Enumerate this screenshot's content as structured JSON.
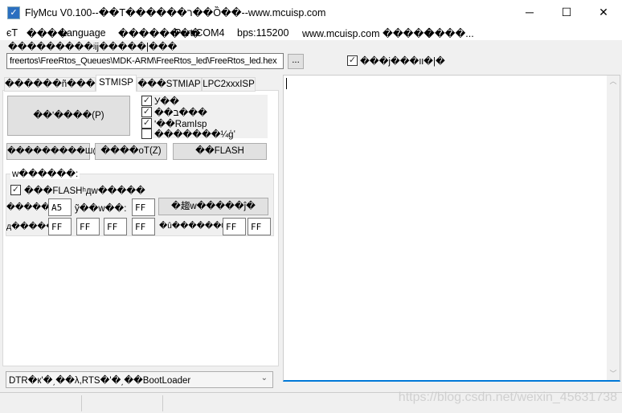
{
  "window": {
    "title": "FlyMcu V0.100--��T������ר��Ȍ��--www.mcuisp.com",
    "minimize": "─",
    "maximize": "☐",
    "close": "✕"
  },
  "menu": [
    "єT",
    "����",
    "Language",
    "��������",
    "Port:COM4",
    "bps:115200",
    "www.mcuisp.com �����",
    "����..."
  ],
  "file": {
    "label": "���������ʲij�����|���",
    "path": "freertos\\FreeRtos_Queues\\MDK-ARM\\FreeRtos_led\\FreeRtos_led.hex",
    "browse": "...",
    "reload_label": "���j���װ�|�",
    "reload_checked": true
  },
  "tabs": [
    {
      "label": "������ñ�����"
    },
    {
      "label": "STMISP",
      "active": true
    },
    {
      "label": "���STMIAP"
    },
    {
      "label": "LPC2xxxISP"
    }
  ],
  "stmisp": {
    "program_button": "��ʹ����(P)",
    "options": [
      {
        "label": "У��",
        "checked": true
      },
      {
        "label": "��ב���",
        "checked": true
      },
      {
        "label": "ʹ��RamIsp",
        "checked": true
      },
      {
        "label": "�������¼ģʽ",
        "checked": false
      }
    ],
    "read_button": "���������Ш(R",
    "erase_button": "����oT(Z)",
    "flash_button": "��FLASH",
    "group_label": "w������:",
    "flash_protect_label": "���FLASHʰдw�����",
    "flash_protect_checked": true,
    "rdp_label": "�����",
    "rdp_value": "A5",
    "user_label": "ỹ��w��:",
    "user_value": "FF",
    "apply_button": "�趨w�����ĵ�",
    "wrp_label": "д�����",
    "wrp_values": [
      "FF",
      "FF",
      "FF",
      "FF"
    ],
    "data_label": "�û������0",
    "data_values": [
      "FF",
      "FF"
    ]
  },
  "bootmode": {
    "selected": "DTR�к'�͵��λ,RTS�'�͵��BootLoader"
  },
  "watermark": "https://blog.csdn.net/weixin_45631738"
}
